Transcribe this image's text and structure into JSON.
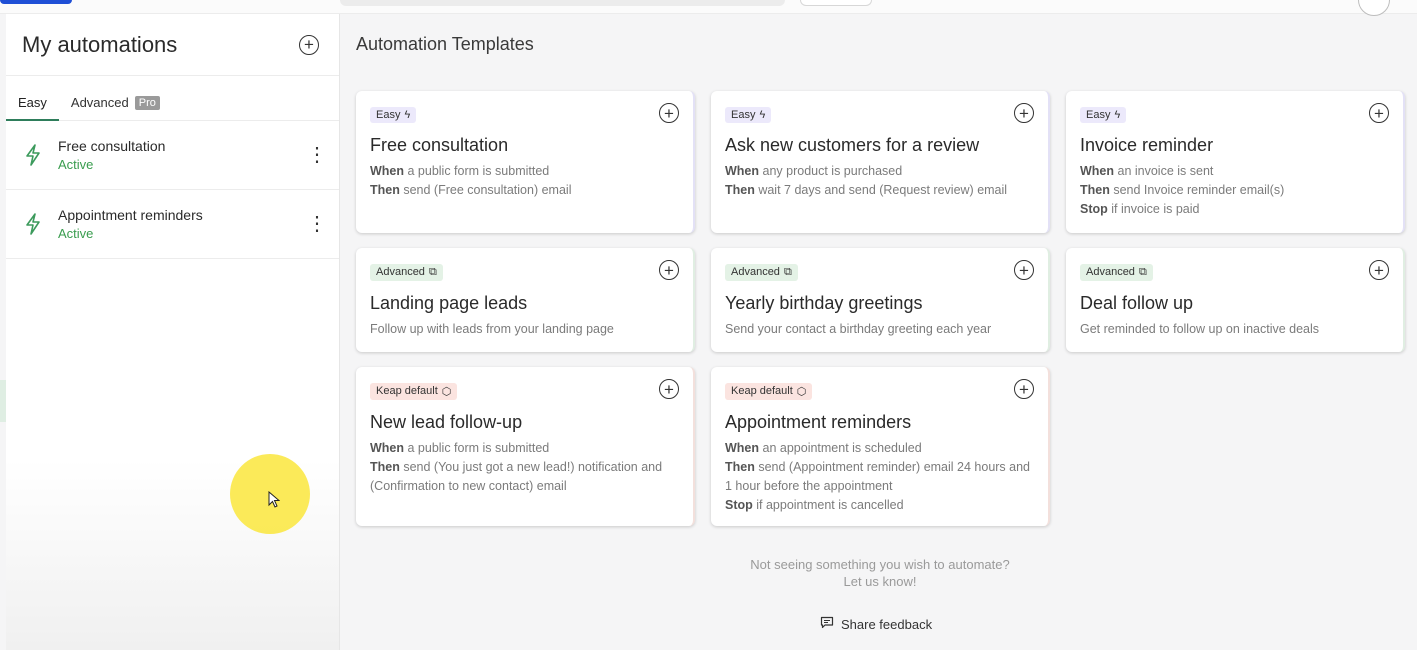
{
  "sidebar": {
    "title": "My automations",
    "tabs": [
      {
        "label": "Easy"
      },
      {
        "label": "Advanced",
        "badge": "Pro"
      }
    ],
    "items": [
      {
        "name": "Free consultation",
        "status": "Active"
      },
      {
        "name": "Appointment reminders",
        "status": "Active"
      }
    ]
  },
  "main": {
    "title": "Automation Templates",
    "cards": [
      {
        "badge": "Easy",
        "title": "Free consultation",
        "lines": [
          [
            "When",
            " a public form is submitted"
          ],
          [
            "Then",
            " send (Free consultation) email"
          ]
        ]
      },
      {
        "badge": "Easy",
        "title": "Ask new customers for a review",
        "lines": [
          [
            "When",
            " any product is purchased"
          ],
          [
            "Then",
            " wait 7 days and send (Request review) email"
          ]
        ]
      },
      {
        "badge": "Easy",
        "title": "Invoice reminder",
        "lines": [
          [
            "When",
            " an invoice is sent"
          ],
          [
            "Then",
            " send Invoice reminder email(s)"
          ],
          [
            "Stop",
            " if invoice is paid"
          ]
        ]
      },
      {
        "badge": "Advanced",
        "title": "Landing page leads",
        "desc": "Follow up with leads from your landing page"
      },
      {
        "badge": "Advanced",
        "title": "Yearly birthday greetings",
        "desc": "Send your contact a birthday greeting each year"
      },
      {
        "badge": "Advanced",
        "title": "Deal follow up",
        "desc": "Get reminded to follow up on inactive deals"
      },
      {
        "badge": "Keap default",
        "title": "New lead follow-up",
        "lines": [
          [
            "When",
            " a public form is submitted"
          ],
          [
            "Then",
            " send (You just got a new lead!) notification and (Confirmation to new contact) email"
          ]
        ]
      },
      {
        "badge": "Keap default",
        "title": "Appointment reminders",
        "lines": [
          [
            "When",
            " an appointment is scheduled"
          ],
          [
            "Then",
            " send (Appointment reminder) email 24 hours and 1 hour before the appointment"
          ],
          [
            "Stop",
            " if appointment is cancelled"
          ]
        ]
      }
    ],
    "footer_line1": "Not seeing something you wish to automate?",
    "footer_line2": "Let us know!",
    "feedback_label": "Share feedback"
  }
}
